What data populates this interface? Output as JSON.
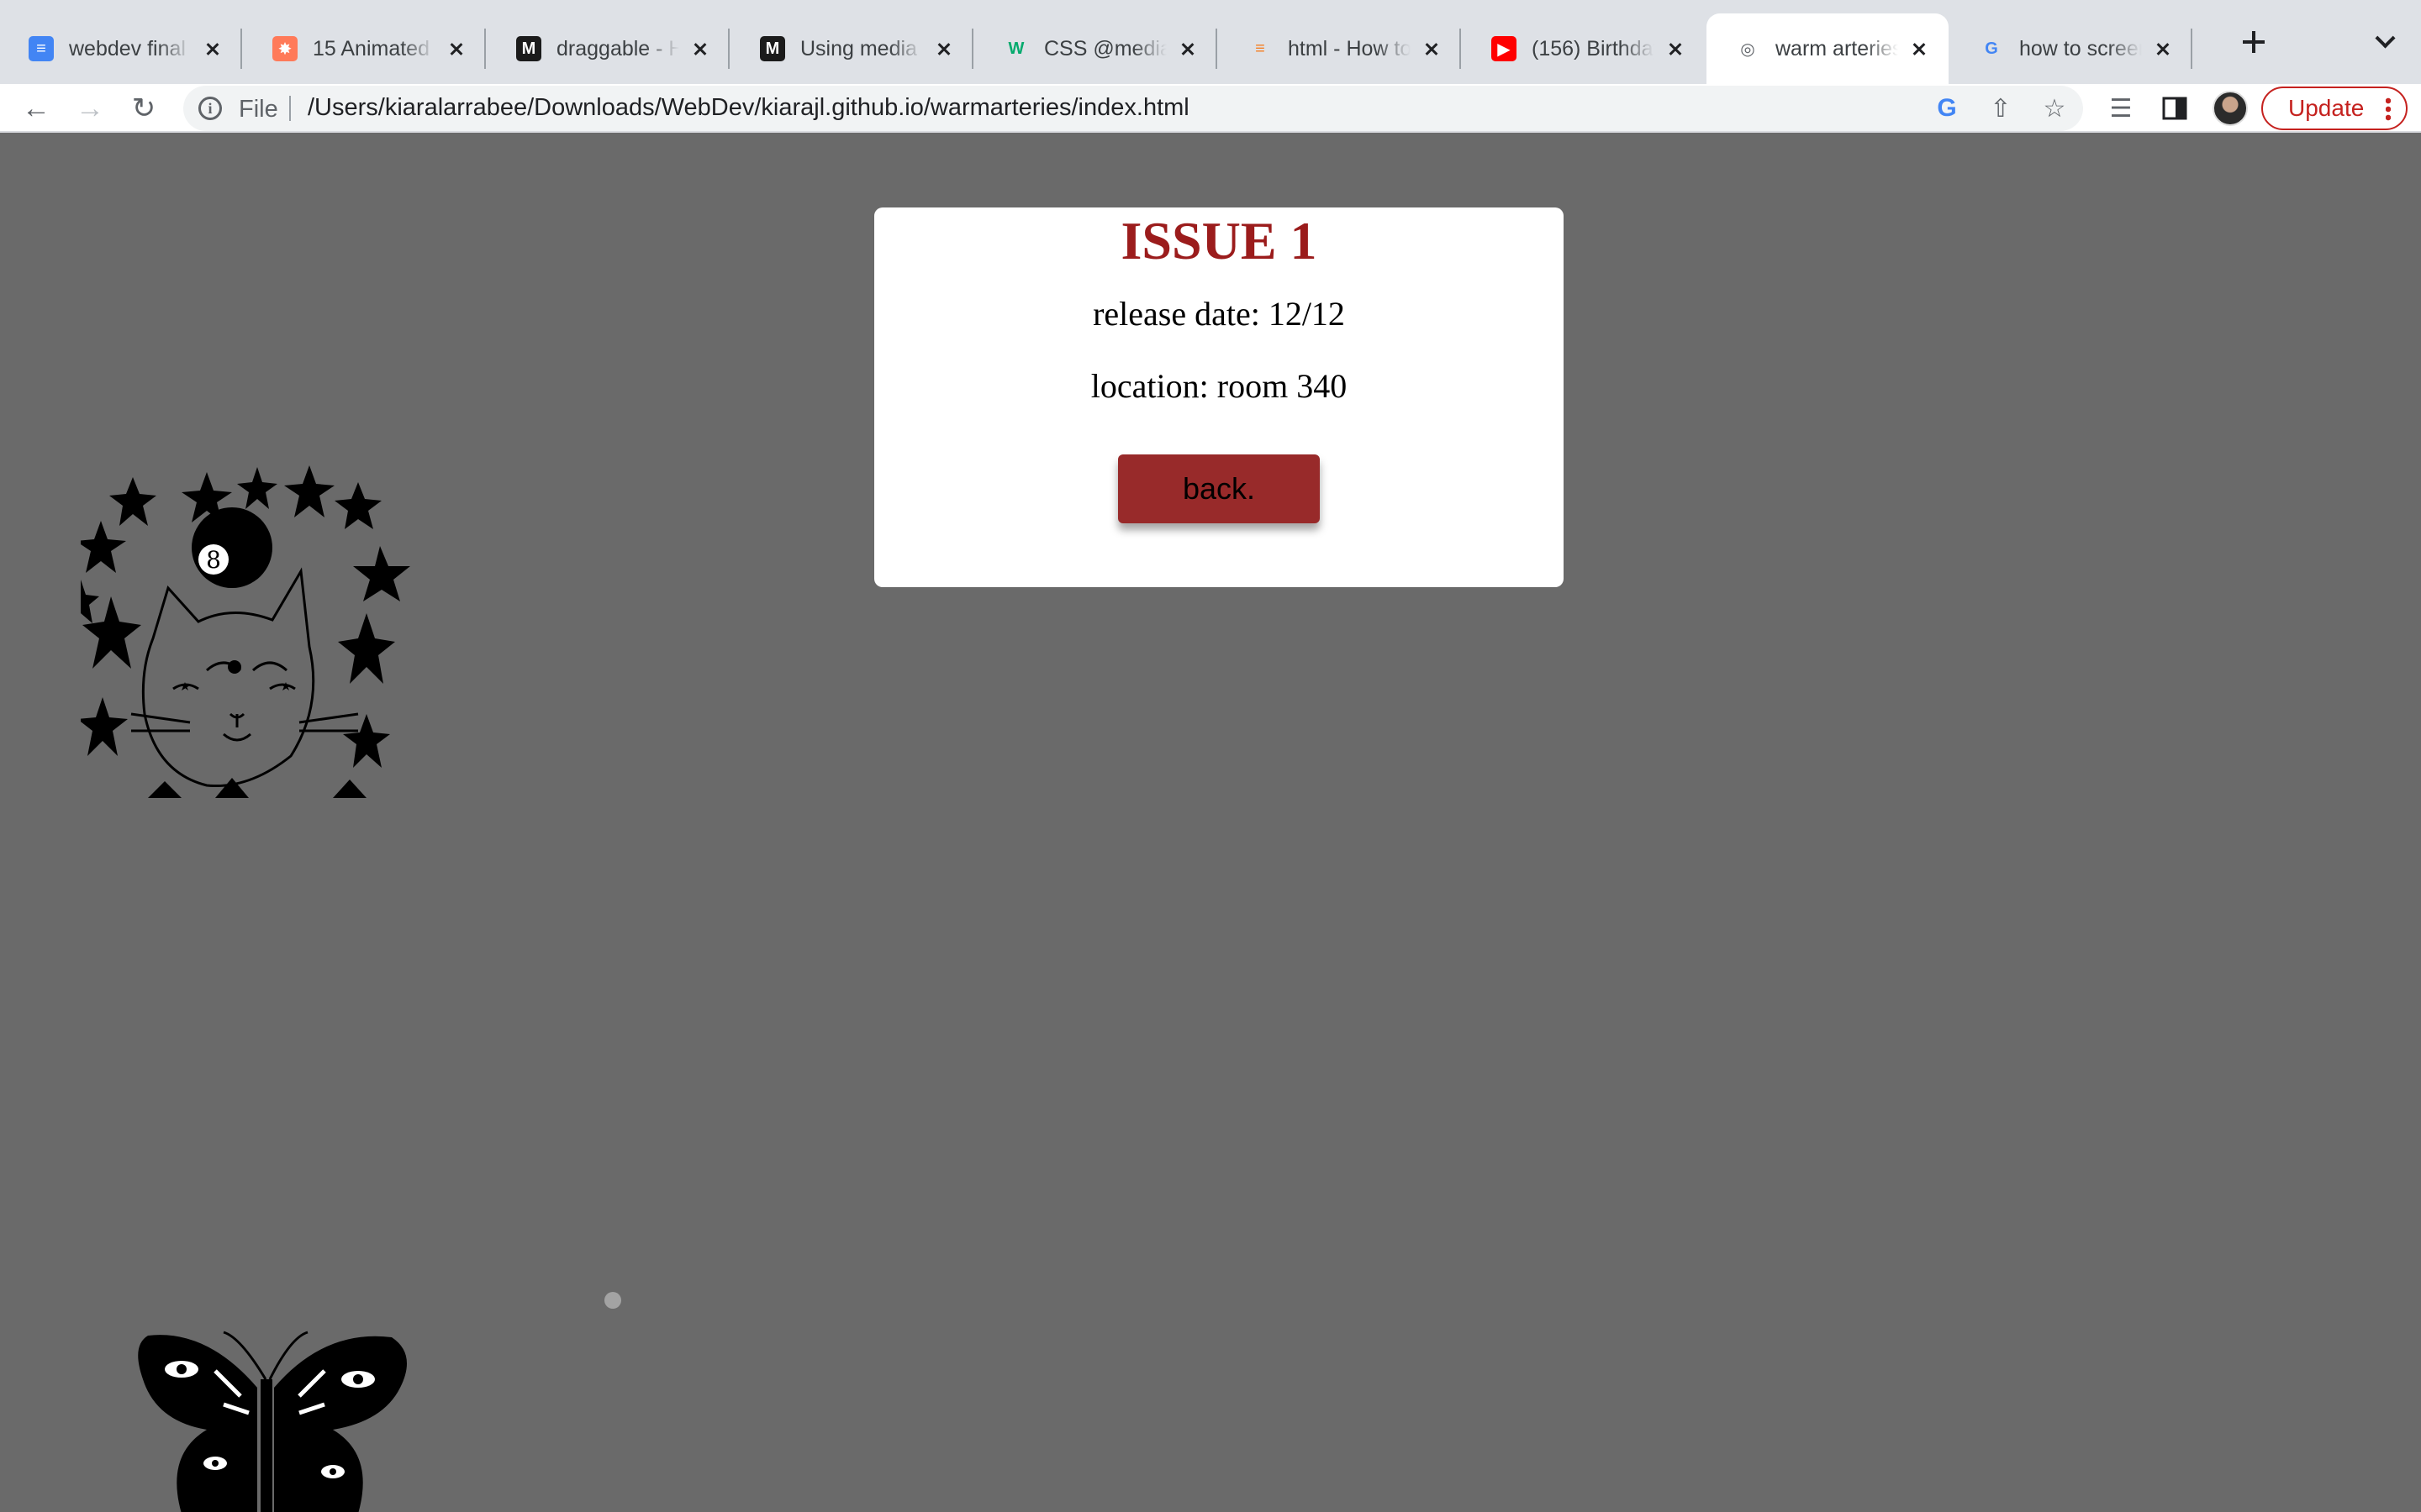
{
  "browser": {
    "tabs": [
      {
        "title": "webdev final - ",
        "favicon": "google-docs-icon",
        "color": "#4285f4"
      },
      {
        "title": "15 Animated C",
        "favicon": "hubspot-icon",
        "color": "#ff7a59"
      },
      {
        "title": "draggable - H",
        "favicon": "mdn-icon",
        "color": "#1b1b1b"
      },
      {
        "title": "Using media q",
        "favicon": "mdn-icon",
        "color": "#1b1b1b"
      },
      {
        "title": "CSS @media R",
        "favicon": "w3schools-icon",
        "color": "#04aa6d"
      },
      {
        "title": "html - How to",
        "favicon": "stackoverflow-icon",
        "color": "#f48024"
      },
      {
        "title": "(156) Birthday",
        "favicon": "youtube-icon",
        "color": "#ff0000"
      },
      {
        "title": "warm arteries",
        "favicon": "globe-icon",
        "color": "#5f6368"
      },
      {
        "title": "how to screen",
        "favicon": "google-icon",
        "color": "#4285f4"
      }
    ],
    "active_tab_index": 7,
    "address": {
      "scheme": "File",
      "url": "/Users/kiaralarrabee/Downloads/WebDev/kiarajl.github.io/warmarteries/index.html"
    },
    "update_label": "Update"
  },
  "modal": {
    "title": "ISSUE 1",
    "release": "release date: 12/12",
    "location": "location: room 340",
    "back_label": "back."
  },
  "colors": {
    "page_background": "#6a6a6a",
    "title": "#9b1c1c",
    "back_button": "#982a2a"
  }
}
